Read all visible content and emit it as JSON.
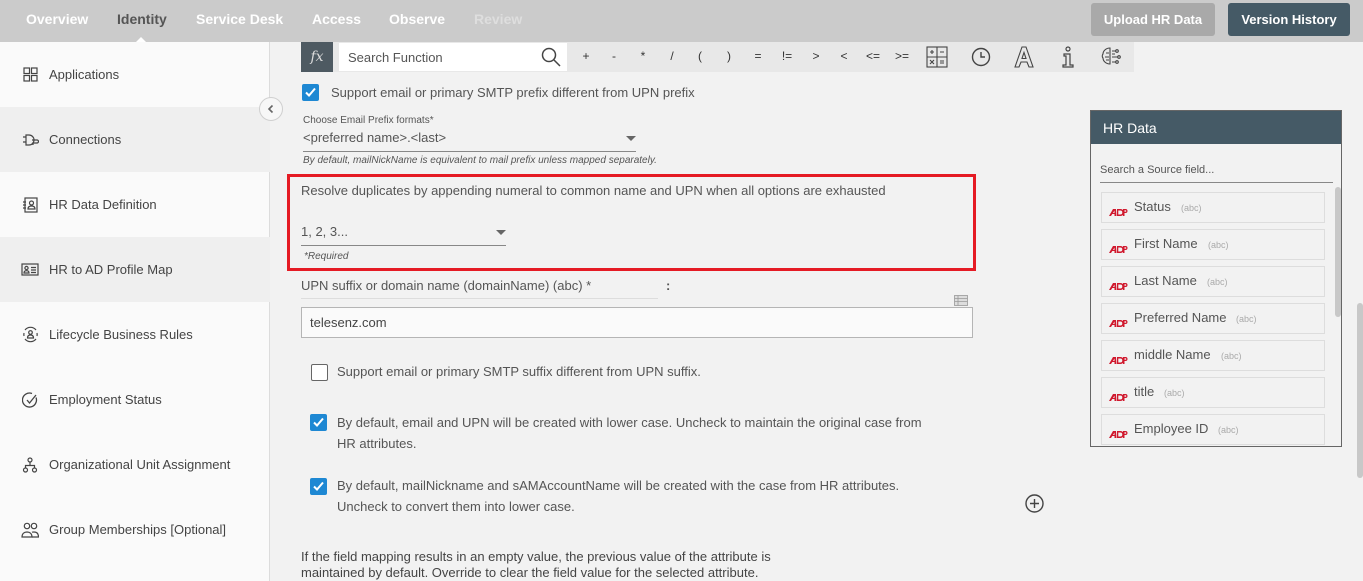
{
  "nav": {
    "tabs": [
      {
        "label": "Overview",
        "state": "normal"
      },
      {
        "label": "Identity",
        "state": "active"
      },
      {
        "label": "Service Desk",
        "state": "normal"
      },
      {
        "label": "Access",
        "state": "normal"
      },
      {
        "label": "Observe",
        "state": "normal"
      },
      {
        "label": "Review",
        "state": "disabled"
      }
    ],
    "upload_label": "Upload HR Data",
    "version_label": "Version History"
  },
  "sidebar": {
    "items": [
      {
        "label": "Applications",
        "icon": "grid-icon"
      },
      {
        "label": "Connections",
        "icon": "plug-icon"
      },
      {
        "label": "HR Data Definition",
        "icon": "contact-book-icon"
      },
      {
        "label": "HR to AD Profile Map",
        "icon": "id-card-icon"
      },
      {
        "label": "Lifecycle Business Rules",
        "icon": "user-cycle-icon"
      },
      {
        "label": "Employment Status",
        "icon": "check-circle-icon"
      },
      {
        "label": "Organizational Unit Assignment",
        "icon": "org-chart-icon"
      },
      {
        "label": "Group Memberships [Optional]",
        "icon": "users-icon"
      }
    ]
  },
  "formula_bar": {
    "fx_label": "fx",
    "search_placeholder": "Search Function",
    "operators": [
      "+",
      "-",
      "*",
      "/",
      "(",
      ")",
      "=",
      "!=",
      ">",
      "<",
      "<=",
      ">="
    ],
    "tools": [
      "calculator-icon",
      "clock-icon",
      "text-icon",
      "info-icon",
      "ai-brain-icon"
    ]
  },
  "form": {
    "smtp_prefix_checkbox": {
      "label": "Support email or primary SMTP prefix different from UPN prefix",
      "checked": true
    },
    "email_prefix": {
      "label": "Choose Email Prefix formats*",
      "value": "<preferred name>.<last>",
      "hint": "By default, mailNickName is equivalent to mail prefix unless mapped separately."
    },
    "duplicates": {
      "label": "Resolve duplicates by appending numeral to common name and UPN when all options are exhausted",
      "value": "1, 2, 3...",
      "hint": "*Required"
    },
    "upn_suffix": {
      "label": "UPN suffix or domain name (domainName) (abc) *",
      "separator": ":",
      "value": "telesenz.com"
    },
    "smtp_suffix_checkbox": {
      "label": "Support email or primary SMTP suffix different from UPN suffix.",
      "checked": false
    },
    "lowercase_checkbox": {
      "label_line1": "By default, email and UPN will be created with lower case. Uncheck to maintain the original case from",
      "label_line2": "HR attributes.",
      "checked": true
    },
    "case_checkbox": {
      "label_line1": "By default, mailNickname and sAMAccountName will be created with the case from HR attributes.",
      "label_line2": "Uncheck to convert them into lower case.",
      "checked": true
    },
    "empty_value_note": {
      "line1": "If the field mapping results in an empty value, the previous value of the attribute is",
      "line2": "maintained by default. Override to clear the field value for the selected attribute."
    }
  },
  "hr_panel": {
    "title": "HR Data",
    "search_placeholder": "Search a Source field...",
    "fields": [
      {
        "name": "Status",
        "type": "(abc)"
      },
      {
        "name": "First Name",
        "type": "(abc)"
      },
      {
        "name": "Last Name",
        "type": "(abc)"
      },
      {
        "name": "Preferred Name",
        "type": "(abc)"
      },
      {
        "name": "middle Name",
        "type": "(abc)"
      },
      {
        "name": "title",
        "type": "(abc)"
      },
      {
        "name": "Employee ID",
        "type": "(abc)"
      }
    ]
  },
  "colors": {
    "accent": "#1e88d3",
    "header_dark": "#455a66",
    "highlight": "#e51b24",
    "adp_red": "#d0182d"
  }
}
